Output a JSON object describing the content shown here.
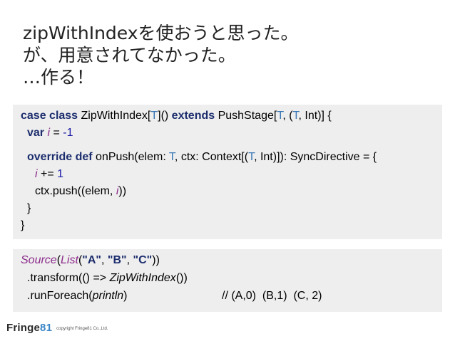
{
  "title": {
    "line1": "zipWithIndexを使おうと思った。",
    "line2": "が、用意されてなかった。",
    "line3": "…作る！"
  },
  "code1": {
    "l1": {
      "case_class": "case class",
      "name": " ZipWithIndex[",
      "t1": "T",
      "mid": "]() ",
      "extends": "extends",
      "push": " PushStage[",
      "t2": "T",
      "mid2": ", (",
      "t3": "T",
      "end": ", Int)] {"
    },
    "l2": {
      "var_kw": "var",
      "i": "i",
      "eq": " = ",
      "num": "-1"
    },
    "l3": {
      "override_def": "override def",
      "sig1": " onPush(elem: ",
      "t1": "T",
      "sig2": ", ctx: Context[(",
      "t2": "T",
      "sig3": ", Int)]): SyncDirective = {"
    },
    "l4": {
      "i": "i",
      "op": " += ",
      "num": "1"
    },
    "l5": {
      "pre": "ctx.push((elem, ",
      "i": "i",
      "post": "))"
    },
    "l6": "}",
    "l7": "}"
  },
  "code2": {
    "l1": {
      "source": "Source",
      "p1": "(",
      "list": "List",
      "p2": "(",
      "a": "\"A\"",
      "c1": ", ",
      "b": "\"B\"",
      "c2": ", ",
      "c": "\"C\"",
      "p3": "))"
    },
    "l2": {
      "pre": ".transform(() => ",
      "zwi": "ZipWithIndex",
      "post": "())"
    },
    "l3": {
      "pre": ".runForeach(",
      "println": "println",
      "post": ")",
      "comment": "// (A,0)  (B,1)  (C, 2)"
    }
  },
  "footer": {
    "logo_text": "Fringe",
    "logo_num": "81",
    "copyright": "copyright Fringe81 Co.,Ltd."
  }
}
